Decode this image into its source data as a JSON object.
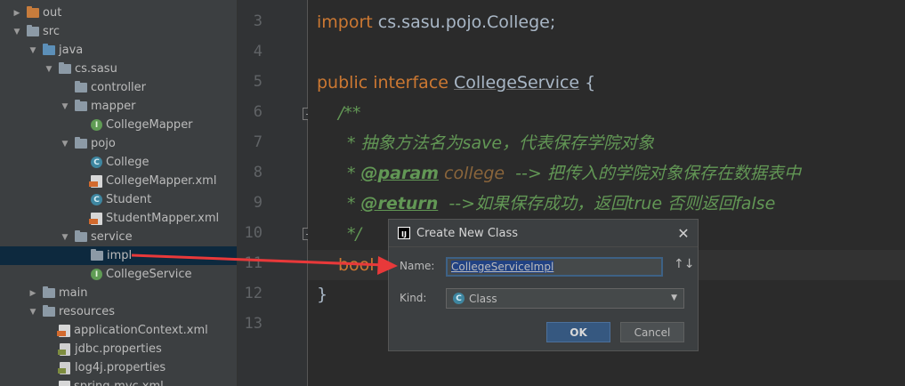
{
  "project_tree": {
    "items": [
      {
        "label": "out",
        "level": 0,
        "expanded": false,
        "icon": "folder-orange-icon"
      },
      {
        "label": "src",
        "level": 0,
        "expanded": true,
        "icon": "folder-icon"
      },
      {
        "label": "java",
        "level": 1,
        "expanded": true,
        "icon": "folder-blue-icon"
      },
      {
        "label": "cs.sasu",
        "level": 2,
        "expanded": true,
        "icon": "package-icon"
      },
      {
        "label": "controller",
        "level": 3,
        "expanded": null,
        "icon": "package-icon"
      },
      {
        "label": "mapper",
        "level": 3,
        "expanded": true,
        "icon": "package-icon"
      },
      {
        "label": "CollegeMapper",
        "level": 4,
        "expanded": null,
        "icon": "interface-icon"
      },
      {
        "label": "pojo",
        "level": 3,
        "expanded": true,
        "icon": "package-icon"
      },
      {
        "label": "College",
        "level": 4,
        "expanded": null,
        "icon": "class-icon"
      },
      {
        "label": "CollegeMapper.xml",
        "level": 4,
        "expanded": null,
        "icon": "xml-file-icon"
      },
      {
        "label": "Student",
        "level": 4,
        "expanded": null,
        "icon": "class-icon"
      },
      {
        "label": "StudentMapper.xml",
        "level": 4,
        "expanded": null,
        "icon": "xml-file-icon"
      },
      {
        "label": "service",
        "level": 3,
        "expanded": true,
        "icon": "package-icon"
      },
      {
        "label": "impl",
        "level": 4,
        "expanded": null,
        "icon": "package-icon",
        "selected": true
      },
      {
        "label": "CollegeService",
        "level": 4,
        "expanded": null,
        "icon": "interface-icon"
      },
      {
        "label": "main",
        "level": 1,
        "expanded": false,
        "icon": "folder-icon"
      },
      {
        "label": "resources",
        "level": 1,
        "expanded": true,
        "icon": "folder-icon"
      },
      {
        "label": "applicationContext.xml",
        "level": 2,
        "expanded": null,
        "icon": "xml-file-icon"
      },
      {
        "label": "jdbc.properties",
        "level": 2,
        "expanded": null,
        "icon": "properties-file-icon"
      },
      {
        "label": "log4j.properties",
        "level": 2,
        "expanded": null,
        "icon": "properties-file-icon"
      },
      {
        "label": "spring-mvc.xml",
        "level": 2,
        "expanded": null,
        "icon": "xml-file-icon"
      }
    ]
  },
  "editor": {
    "line_numbers": [
      "3",
      "4",
      "5",
      "6",
      "7",
      "8",
      "9",
      "10",
      "11",
      "12",
      "13"
    ],
    "code": {
      "l3_kw": "import ",
      "l3_rest": "cs.sasu.pojo.College;",
      "l5_kw1": "public ",
      "l5_kw2": "interface ",
      "l5_name": "CollegeService",
      "l5_brace": " {",
      "l6": "/**",
      "l7": "* 抽象方法名为save，代表保存学院对象",
      "l8_star": "* ",
      "l8_tag": "@param",
      "l8_val": " college",
      "l8_rest": "  --> 把传入的学院对象保存在数据表中",
      "l9_star": "* ",
      "l9_tag": "@return",
      "l9_rest": "  -->如果保存成功，返回true 否则返回false",
      "l10": "*/",
      "l11": "bool",
      "l12": "}"
    }
  },
  "dialog": {
    "title": "Create New Class",
    "name_label": "Name:",
    "name_value": "CollegeServiceImpl",
    "kind_label": "Kind:",
    "kind_value": "Class",
    "sort_glyph": "↑↓",
    "ok_label": "OK",
    "cancel_label": "Cancel",
    "close_glyph": "✕",
    "app_icon_text": "IJ"
  },
  "annotation": {
    "color": "#e8393a"
  }
}
